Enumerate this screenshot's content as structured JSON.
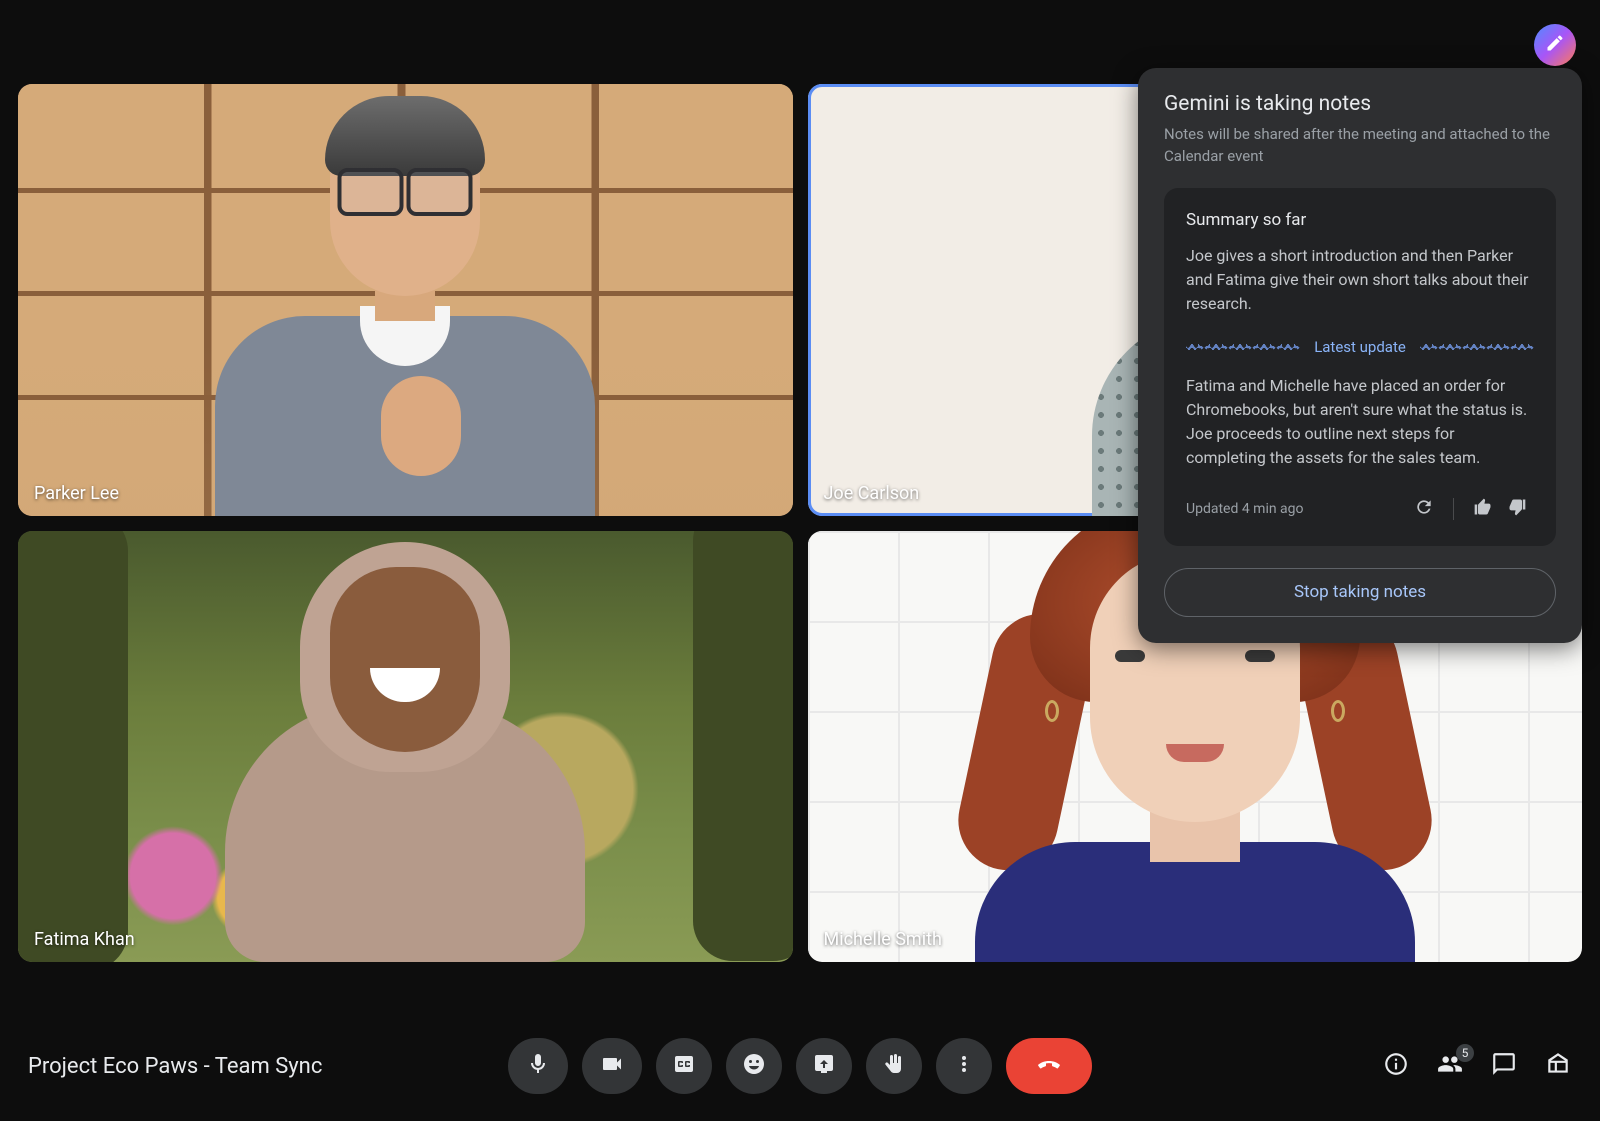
{
  "meeting": {
    "title": "Project Eco Paws - Team Sync"
  },
  "participants": [
    {
      "name": "Parker Lee",
      "speaking": false
    },
    {
      "name": "Joe Carlson",
      "speaking": true
    },
    {
      "name": "Fatima Khan",
      "speaking": false
    },
    {
      "name": "Michelle Smith",
      "speaking": false
    }
  ],
  "gemini_panel": {
    "title": "Gemini is taking notes",
    "subtitle": "Notes will be shared after the meeting and attached to the Calendar event",
    "summary_heading": "Summary so far",
    "summary_text": "Joe gives a short introduction and then Parker and Fatima give their own short talks about their research.",
    "latest_label": "Latest update",
    "latest_text": "Fatima and Michelle have placed an order for Chromebooks, but aren't sure what the status is. Joe proceeds to outline next steps for completing the assets for the sales team.",
    "updated": "Updated 4 min ago",
    "stop_label": "Stop taking notes"
  },
  "people_count": "5"
}
